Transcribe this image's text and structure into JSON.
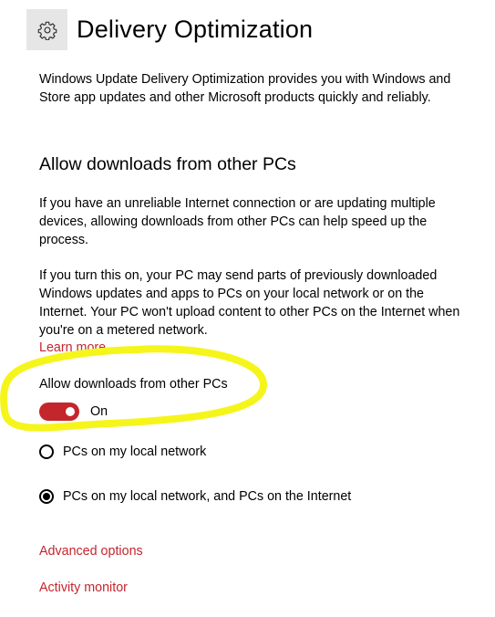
{
  "header": {
    "title": "Delivery Optimization",
    "icon": "gear-icon"
  },
  "intro_text": "Windows Update Delivery Optimization provides you with Windows and Store app updates and other Microsoft products quickly and reliably.",
  "section": {
    "heading": "Allow downloads from other PCs",
    "description1": "If you have an unreliable Internet connection or are updating multiple devices, allowing downloads from other PCs can help speed up the process.",
    "description2": "If you turn this on, your PC may send parts of previously downloaded Windows updates and apps to PCs on your local network or on the Internet. Your PC won't upload content to other PCs on the Internet when you're on a metered network.",
    "learn_more": "Learn more"
  },
  "toggle": {
    "label": "Allow downloads from other PCs",
    "state_text": "On",
    "is_on": true
  },
  "radio_options": [
    {
      "label": "PCs on my local network",
      "selected": false
    },
    {
      "label": "PCs on my local network, and PCs on the Internet",
      "selected": true
    }
  ],
  "links": {
    "advanced_options": "Advanced options",
    "activity_monitor": "Activity monitor"
  },
  "colors": {
    "accent": "#c4262e",
    "highlight_annotation": "#f5f51c",
    "icon_background": "#e6e6e6"
  }
}
